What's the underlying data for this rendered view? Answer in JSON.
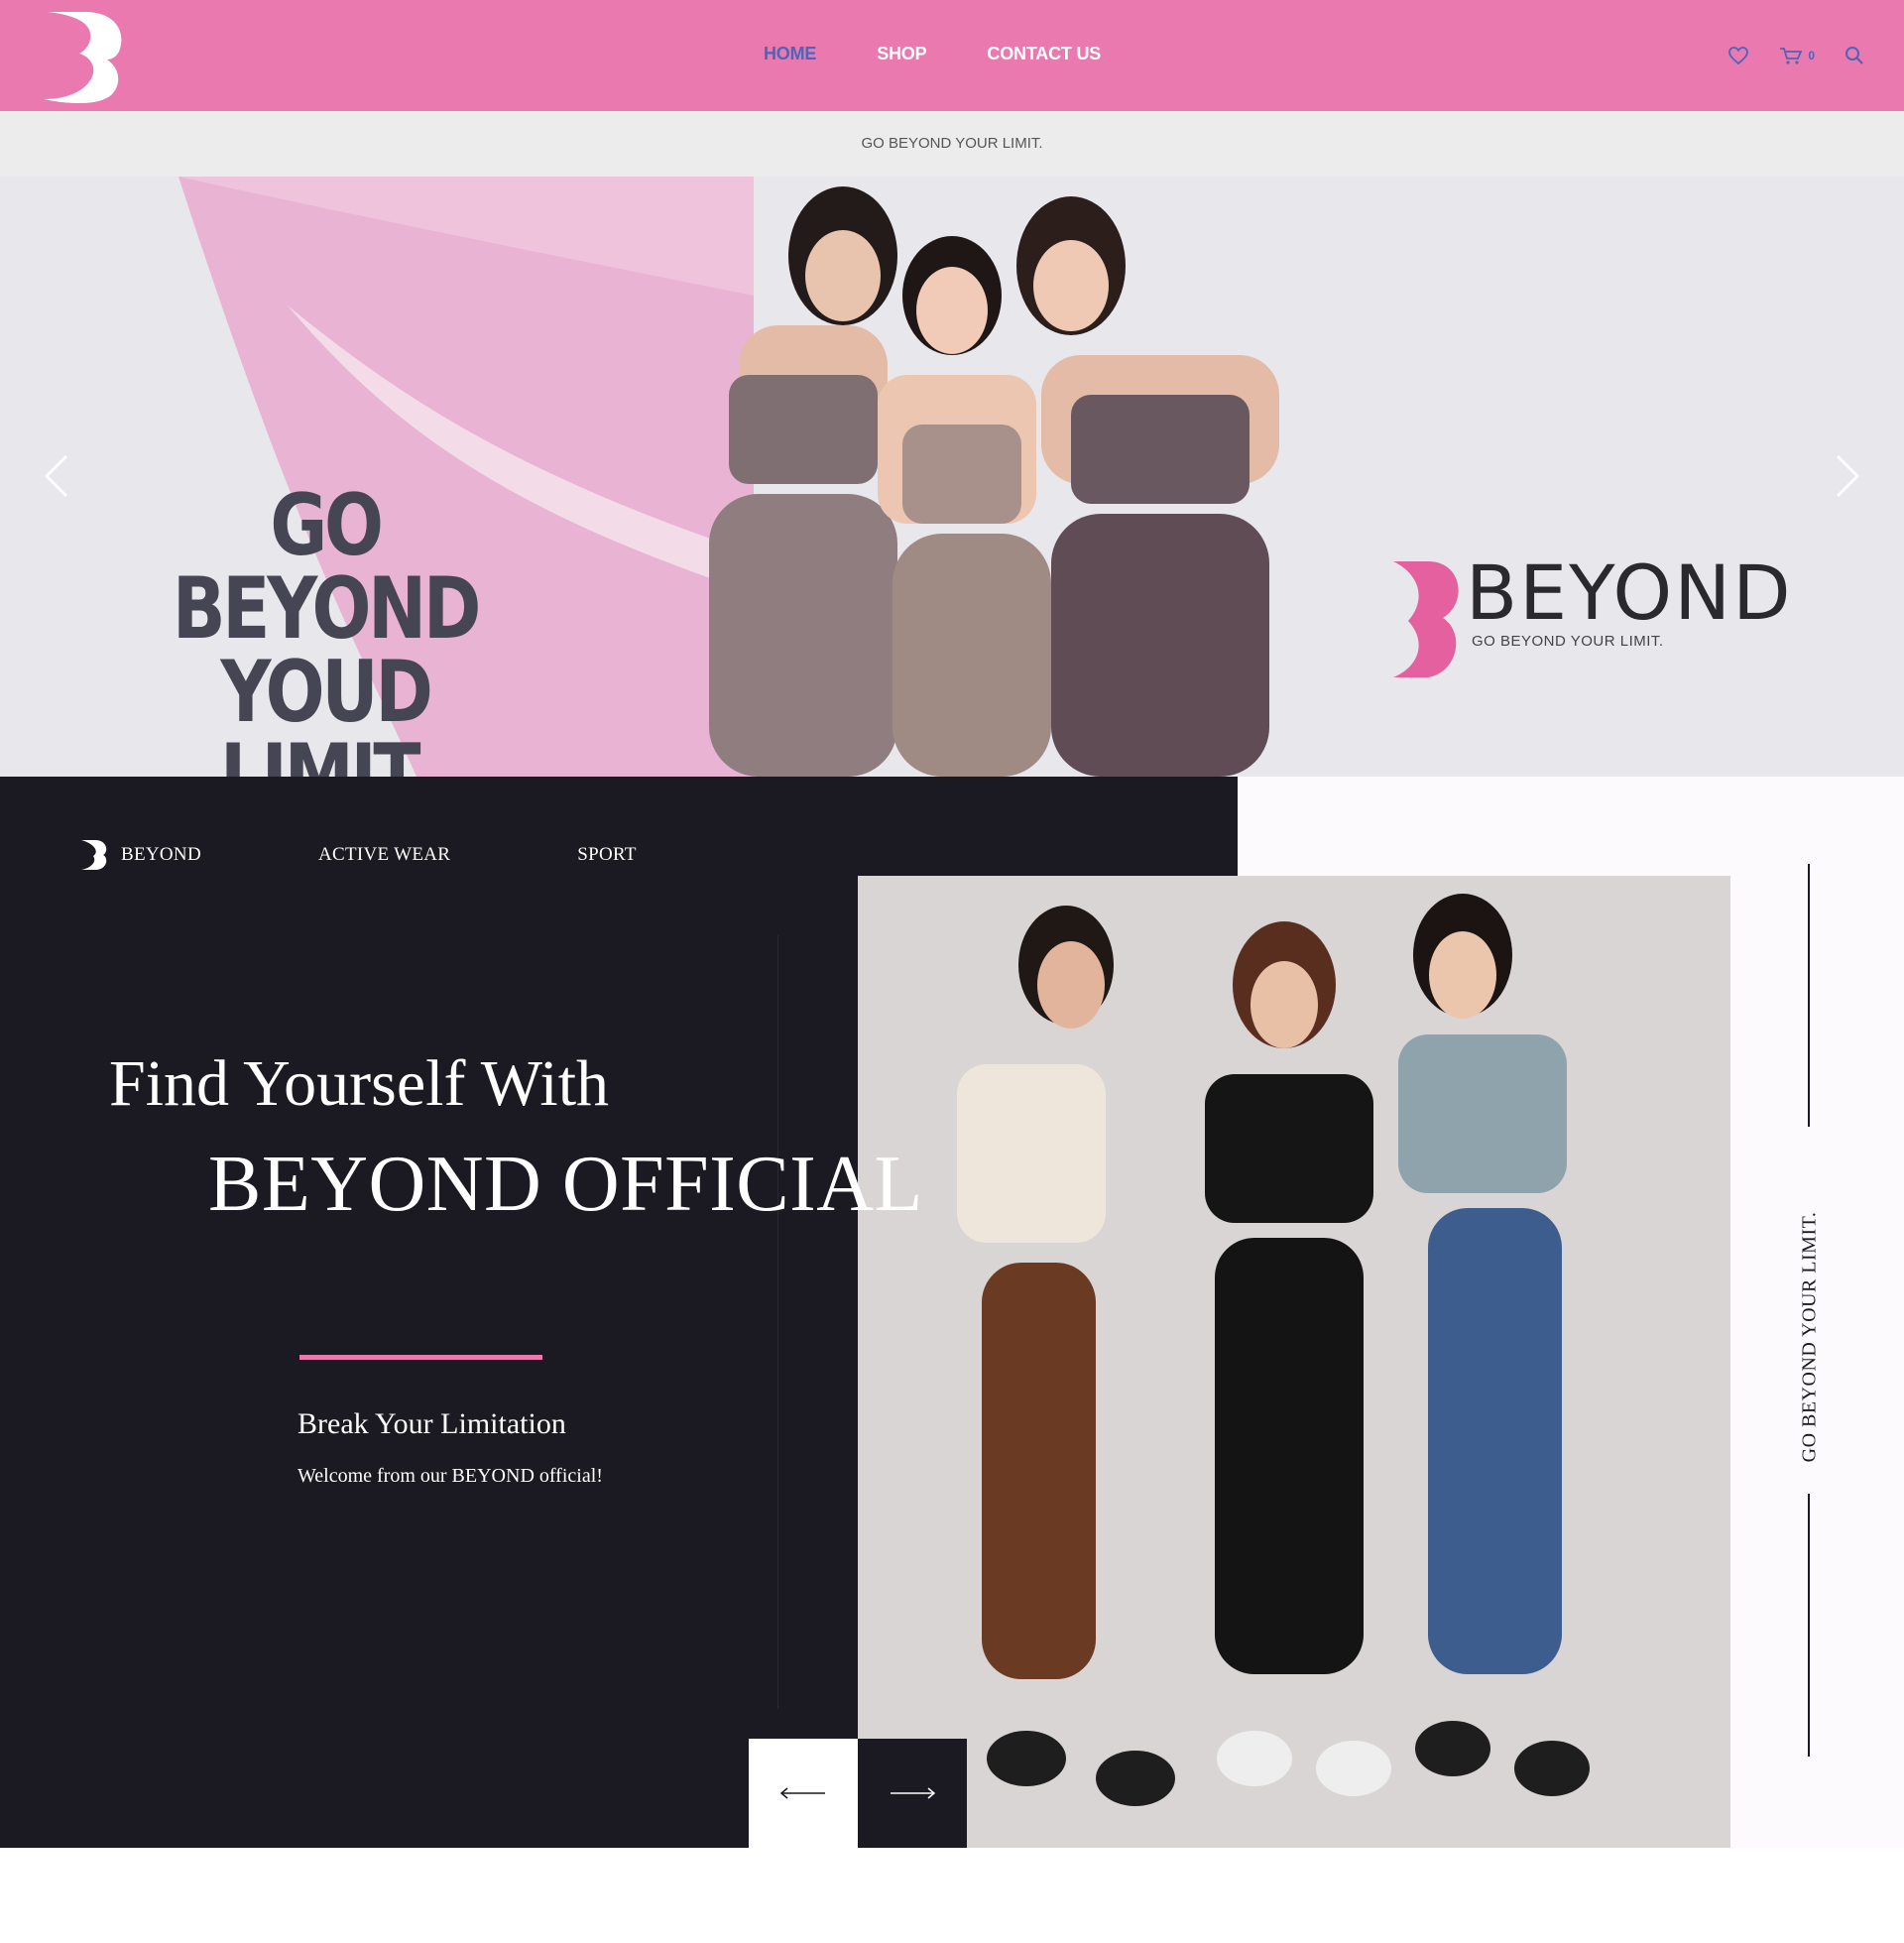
{
  "header": {
    "nav": [
      {
        "label": "HOME",
        "active": true
      },
      {
        "label": "SHOP",
        "active": false
      },
      {
        "label": "CONTACT US",
        "active": false
      }
    ],
    "cart_count": "0",
    "icons": [
      "logo-icon",
      "heart-icon",
      "cart-icon",
      "search-icon"
    ],
    "bg_color": "#ea79b0",
    "active_color": "#4a66b8"
  },
  "announcement": {
    "text": "GO BEYOND YOUR LIMIT."
  },
  "hero": {
    "headline_lines": [
      "GO",
      "BEYOND",
      "YOUD LIMIT."
    ],
    "brand_word": "BEYOND",
    "brand_tagline": "GO BEYOND YOUR LIMIT.",
    "accent_color": "#e690bf"
  },
  "feature": {
    "nav": [
      "BEYOND",
      "ACTIVE WEAR",
      "SPORT"
    ],
    "headline_line1": "Find Yourself With",
    "headline_line2": "BEYOND OFFICIAL",
    "subtitle": "Break Your Limitation",
    "text": "Welcome from our BEYOND official!",
    "side_text": "GO BEYOND YOUR LIMIT.",
    "dark_color": "#1b1921",
    "accent_color": "#ea79b0"
  }
}
